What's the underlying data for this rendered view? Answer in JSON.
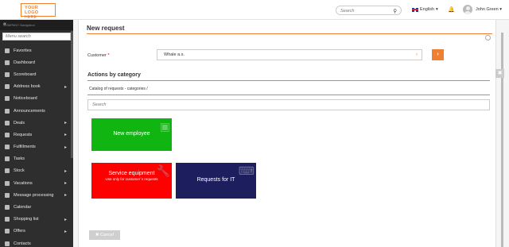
{
  "header": {
    "logo_line1": "YOUR LOGO",
    "logo_line2": "HERE",
    "search_placeholder": "Search",
    "language": "English",
    "user_name": "John Green"
  },
  "sidebar": {
    "title": "COMPANY Navigation",
    "search_placeholder": "Menu search",
    "items": [
      {
        "label": "Favorites",
        "has_submenu": false
      },
      {
        "label": "Dashboard",
        "has_submenu": false
      },
      {
        "label": "Scoreboard",
        "has_submenu": false
      },
      {
        "label": "Address book",
        "has_submenu": true
      },
      {
        "label": "Noticeboard",
        "has_submenu": false
      },
      {
        "label": "Announcements",
        "has_submenu": false
      },
      {
        "label": "Deals",
        "has_submenu": true
      },
      {
        "label": "Requests",
        "has_submenu": true
      },
      {
        "label": "Fulfillments",
        "has_submenu": true
      },
      {
        "label": "Tasks",
        "has_submenu": false
      },
      {
        "label": "Stock",
        "has_submenu": true
      },
      {
        "label": "Vacations",
        "has_submenu": true
      },
      {
        "label": "Message processing",
        "has_submenu": true
      },
      {
        "label": "Calendar",
        "has_submenu": false
      },
      {
        "label": "Shopping list",
        "has_submenu": true
      },
      {
        "label": "Offers",
        "has_submenu": true
      },
      {
        "label": "Contacts",
        "has_submenu": false
      }
    ]
  },
  "main": {
    "title": "New request",
    "customer_label": "Customer",
    "customer_required": "*",
    "customer_value": "Whale a.s.",
    "section_title": "Actions by category",
    "breadcrumb": "Catalog of requests - categories /",
    "category_search_placeholder": "Search",
    "tiles": [
      {
        "title": "New employee",
        "subtitle": "",
        "color": "#11b511",
        "icon": "address-book-icon"
      },
      {
        "title": "Service equipment",
        "subtitle": "Use only for customer´s requests",
        "color": "#ff0000",
        "icon": "wrench-icon"
      },
      {
        "title": "Requests for IT",
        "subtitle": "",
        "color": "#1d1e5e",
        "icon": "keyboard-icon"
      }
    ],
    "cancel_label": "Cancel"
  },
  "colors": {
    "accent": "#f08030",
    "sidebar_bg": "#2e2e2e"
  }
}
